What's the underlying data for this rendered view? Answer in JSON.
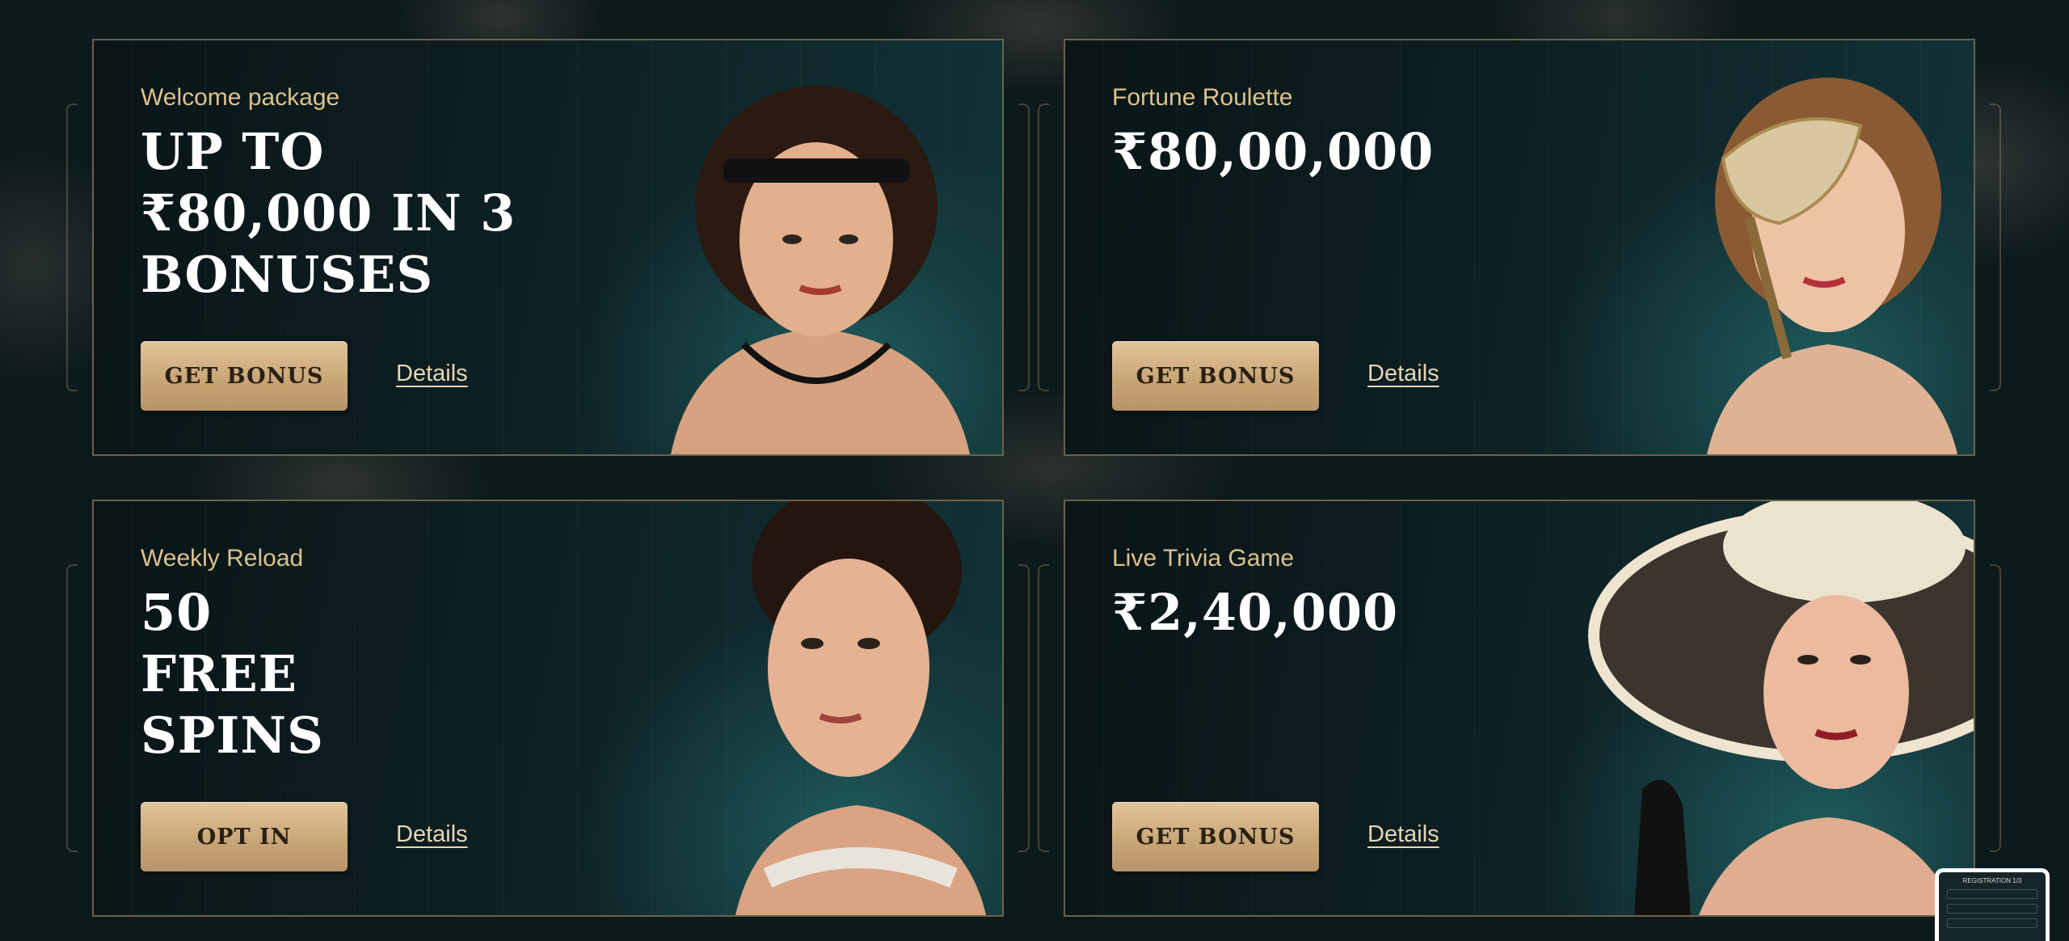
{
  "promos": [
    {
      "subtitle": "Welcome package",
      "headline": "UP TO ₹80,000 IN 3 BONUSES",
      "button_label": "GET BONUS",
      "details_label": "Details"
    },
    {
      "subtitle": "Fortune Roulette",
      "headline": "₹80,00,000",
      "button_label": "GET BONUS",
      "details_label": "Details"
    },
    {
      "subtitle": "Weekly Reload",
      "headline": "50 FREE SPINS",
      "button_label": "OPT IN",
      "details_label": "Details"
    },
    {
      "subtitle": "Live Trivia Game",
      "headline": "₹2,40,000",
      "button_label": "GET BONUS",
      "details_label": "Details"
    }
  ],
  "registration_widget": {
    "title": "REGISTRATION 1/3"
  },
  "colors": {
    "accent_gold": "#dcc28e",
    "button_gold": "#c9a677",
    "card_teal": "#1f5c5e",
    "background": "#0b1517"
  }
}
